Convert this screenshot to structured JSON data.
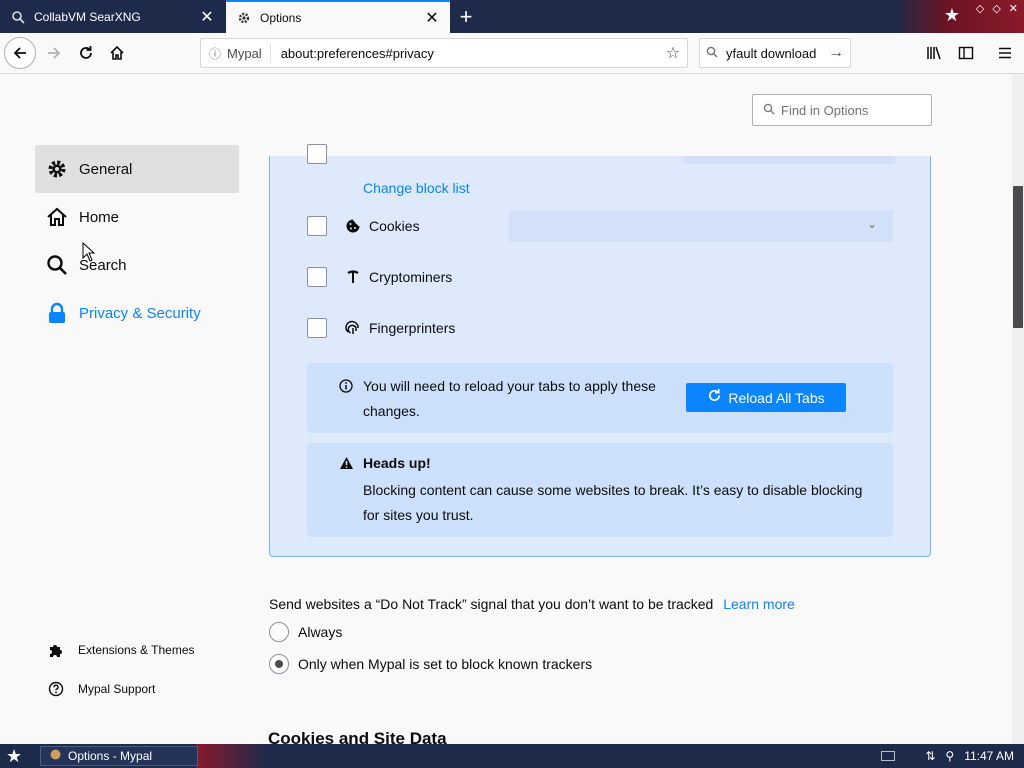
{
  "tabs": [
    {
      "title": "CollabVM SearXNG",
      "icon": "searxng-icon",
      "active": false
    },
    {
      "title": "Options",
      "icon": "gear-icon",
      "active": true
    }
  ],
  "navbar": {
    "identity_label": "Mypal",
    "url": "about:preferences#privacy",
    "search_value": "yfault download"
  },
  "find": {
    "placeholder": "Find in Options"
  },
  "sidebar": {
    "categories": [
      {
        "label": "General",
        "icon": "gear-icon",
        "state": "hover"
      },
      {
        "label": "Home",
        "icon": "home-icon",
        "state": "normal"
      },
      {
        "label": "Search",
        "icon": "search-icon",
        "state": "normal"
      },
      {
        "label": "Privacy & Security",
        "icon": "lock-icon",
        "state": "selected"
      }
    ],
    "footer": [
      {
        "label": "Extensions & Themes",
        "icon": "puzzle-icon"
      },
      {
        "label": "Mypal Support",
        "icon": "help-icon"
      }
    ]
  },
  "tracking": {
    "change_block_list": "Change block list",
    "cookies_label": "Cookies",
    "cryptominers_label": "Cryptominers",
    "fingerprinters_label": "Fingerprinters",
    "reload_notice": "You will need to reload your tabs to apply these changes.",
    "reload_button": "Reload All Tabs",
    "warning_title": "Heads up!",
    "warning_text": "Blocking content can cause some websites to break. It’s easy to disable blocking for sites you trust."
  },
  "dnt": {
    "text": "Send websites a “Do Not Track” signal that you don’t want to be tracked",
    "learn_more": "Learn more",
    "options": [
      {
        "label": "Always",
        "selected": false
      },
      {
        "label": "Only when Mypal is set to block known trackers",
        "selected": true
      }
    ]
  },
  "next_section": "Cookies and Site Data",
  "taskbar": {
    "window_button": "Options - Mypal",
    "clock": "11:47 AM"
  },
  "colors": {
    "accent": "#0a84ff",
    "panel_bg": "#deeafc",
    "notice_bg": "#cce0fb",
    "taskbar": "#1e2a4a"
  }
}
